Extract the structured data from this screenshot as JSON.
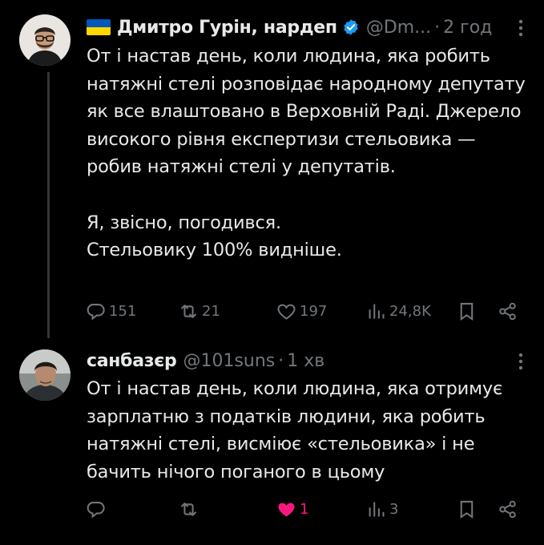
{
  "tweets": [
    {
      "author_name": "Дмитро Гурін, нардеп",
      "handle": "@Dm...",
      "separator": "·",
      "time": "2 год",
      "text": "От і настав день, коли людина, яка робить натяжні стелі розповідає народному депутату як все влаштовано в Верховній Раді. Джерело високого рівня експертизи стельовика — робив натяжні стелі у депутатів.\n\nЯ, звісно, погодився.\nСтельовику 100% видніше.",
      "replies": "151",
      "retweets": "21",
      "likes": "197",
      "views": "24,8K",
      "flag": "ukraine-flag-icon",
      "verified": "verified-badge-icon"
    },
    {
      "author_name": "санбазєр",
      "handle": "@101suns",
      "separator": "·",
      "time": "1 хв",
      "text": "От і настав день, коли людина, яка отримує зарплатню з податків людини, яка робить натяжні стелі, висміює «стельовика» і не бачить нічого поганого в цьому",
      "replies": "",
      "retweets": "",
      "likes": "1",
      "views": "3",
      "liked": true
    }
  ],
  "colors": {
    "background": "#000000",
    "text": "#e7e9ea",
    "muted": "#71767b",
    "verified_blue": "#1d9bf0",
    "like_pink": "#f91880"
  }
}
